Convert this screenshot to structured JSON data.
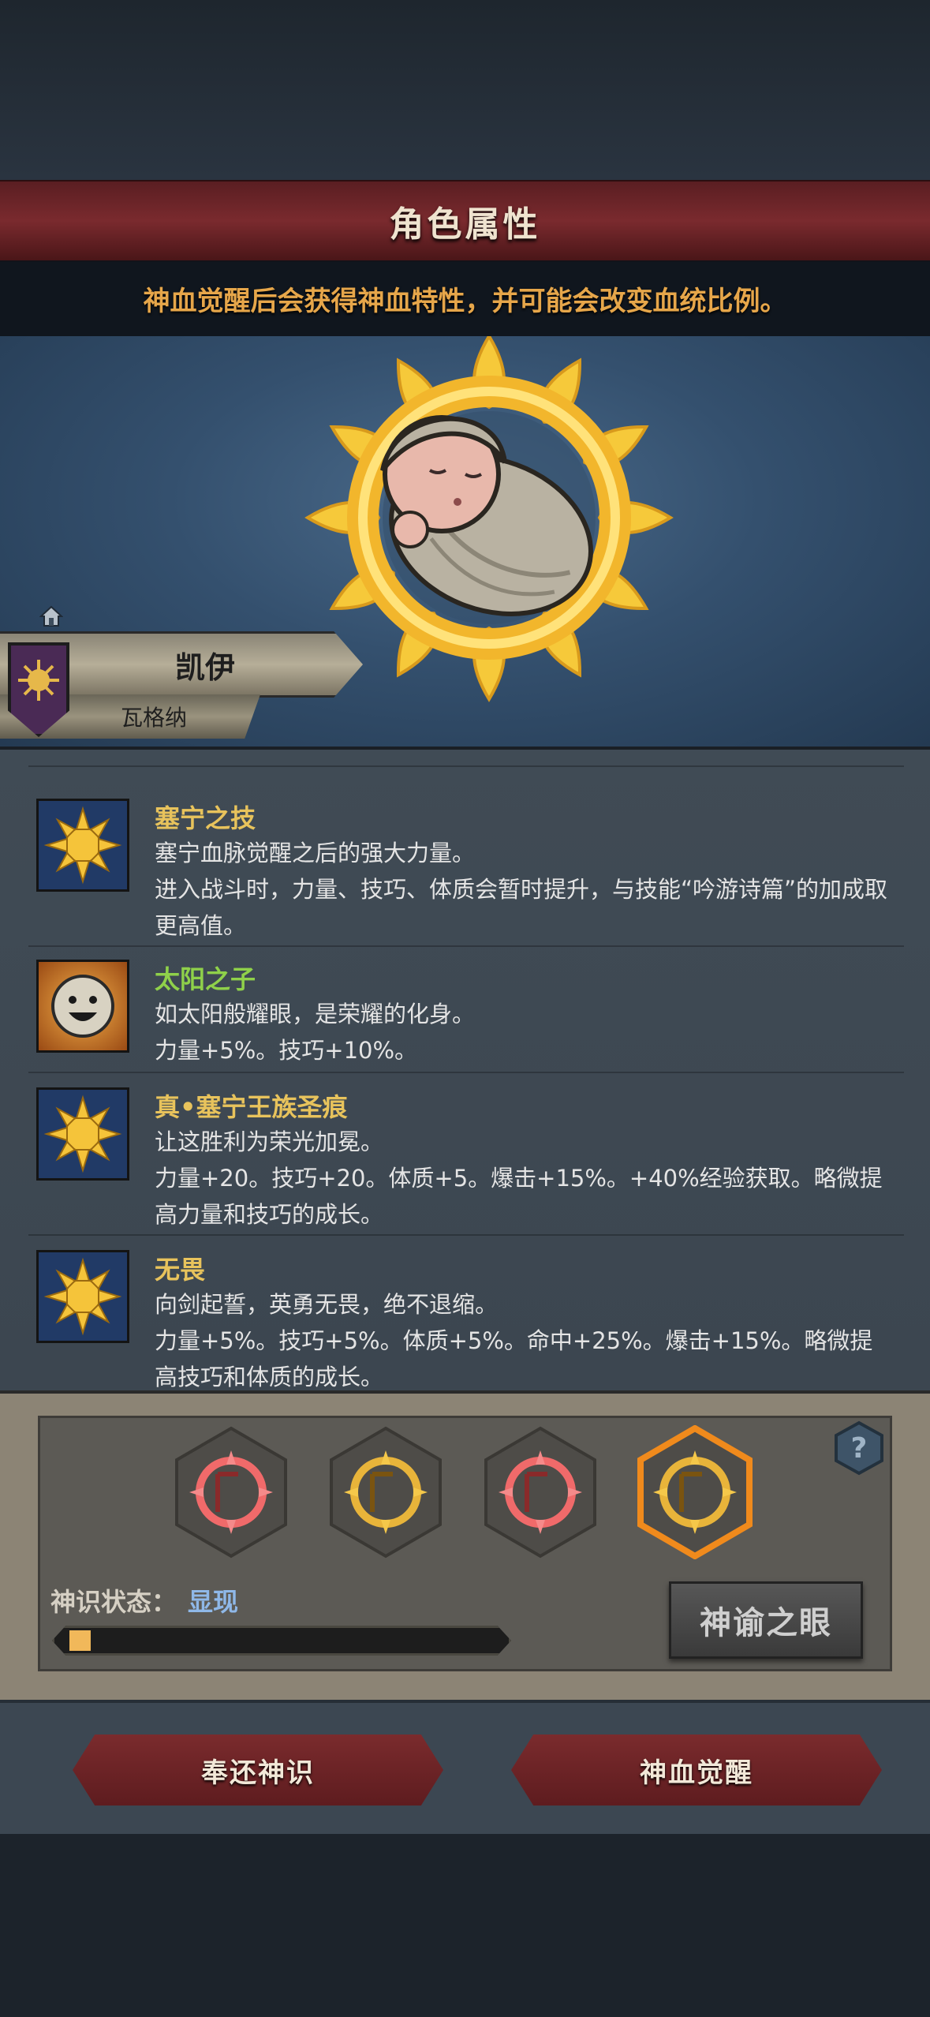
{
  "header": {
    "title": "角色属性",
    "subtitle": "神血觉醒后会获得神血特性，并可能会改变血统比例。"
  },
  "character": {
    "name": "凯伊",
    "clan": "瓦格纳"
  },
  "traits": [
    {
      "name": "塞宁之技",
      "lines": [
        "塞宁血脉觉醒之后的强大力量。",
        "进入战斗时，力量、技巧、体质会暂时提升，与技能“吟游诗篇”的加成取更高值。"
      ],
      "icon": "sun-icon"
    },
    {
      "name": "太阳之子",
      "lines": [
        "如太阳般耀眼，是荣耀的化身。",
        "力量+5%。技巧+10%。"
      ],
      "icon": "smiley-face-icon"
    },
    {
      "name": "真•塞宁王族圣痕",
      "lines": [
        "让这胜利为荣光加冕。",
        "力量+20。技巧+20。体质+5。爆击+15%。+40%经验获取。略微提高力量和技巧的成长。"
      ],
      "icon": "sun-icon"
    },
    {
      "name": "无畏",
      "lines": [
        "向剑起誓，英勇无畏，绝不退缩。",
        "力量+5%。技巧+5%。体质+5%。命中+25%。爆击+15%。略微提高技巧和体质的成长。"
      ],
      "icon": "sun-icon"
    }
  ],
  "divine_sense": {
    "label": "神识状态：",
    "value": "显现",
    "progress": 0.05,
    "slots": [
      "red-sun-emblem-icon",
      "gold-sun-emblem-icon",
      "red-sun-emblem-icon",
      "gold-sun-emblem-icon-selected"
    ]
  },
  "buttons": {
    "oracle": "神谕之眼",
    "return": "奉还神识",
    "awaken": "神血觉醒"
  },
  "colors": {
    "banner": "#6e2428",
    "accent_orange": "#e6a64a",
    "trait_gold": "#e8c35c",
    "trait_green": "#8fd14a",
    "status_blue": "#8fb8e8",
    "progress_fill": "#f1b85a"
  }
}
